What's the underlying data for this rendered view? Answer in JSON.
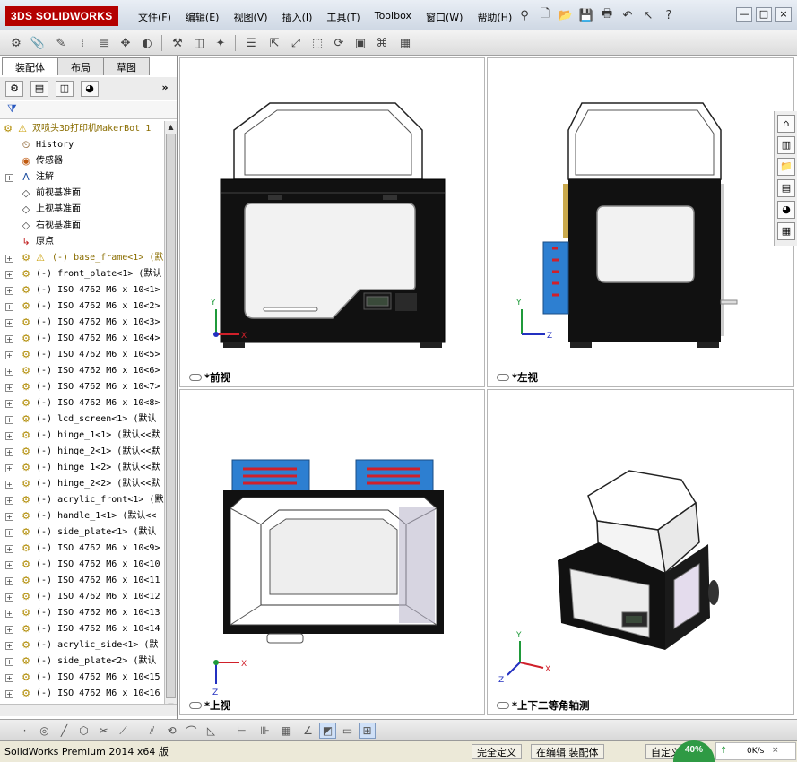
{
  "app": {
    "logo_text": "3DS SOLIDWORKS",
    "menus": [
      "文件(F)",
      "编辑(E)",
      "视图(V)",
      "插入(I)",
      "工具(T)",
      "Toolbox",
      "窗口(W)",
      "帮助(H)"
    ],
    "window_controls": [
      "?",
      "—",
      "□",
      "×"
    ]
  },
  "panel": {
    "tabs": [
      "装配体",
      "布局",
      "草图"
    ],
    "active_tab": "装配体",
    "tree_root": "双喷头3D打印机MakerBot 1",
    "tree_items": [
      {
        "icon": "history-icon",
        "label": "History",
        "expander": ""
      },
      {
        "icon": "sensor-icon",
        "label": "传感器",
        "expander": ""
      },
      {
        "icon": "annotation-icon",
        "label": "注解",
        "expander": "+"
      },
      {
        "icon": "plane-icon",
        "label": "前视基准面",
        "expander": ""
      },
      {
        "icon": "plane-icon",
        "label": "上视基准面",
        "expander": ""
      },
      {
        "icon": "plane-icon",
        "label": "右视基准面",
        "expander": ""
      },
      {
        "icon": "origin-icon",
        "label": "原点",
        "expander": ""
      },
      {
        "icon": "warning-part-icon",
        "label": "(-) base_frame<1> (默",
        "expander": "+",
        "warn": true
      },
      {
        "icon": "part-icon",
        "label": "(-) front_plate<1> (默认",
        "expander": "+"
      },
      {
        "icon": "part-icon",
        "label": "(-) ISO 4762 M6 x 10<1>",
        "expander": "+"
      },
      {
        "icon": "part-icon",
        "label": "(-) ISO 4762 M6 x 10<2>",
        "expander": "+"
      },
      {
        "icon": "part-icon",
        "label": "(-) ISO 4762 M6 x 10<3>",
        "expander": "+"
      },
      {
        "icon": "part-icon",
        "label": "(-) ISO 4762 M6 x 10<4>",
        "expander": "+"
      },
      {
        "icon": "part-icon",
        "label": "(-) ISO 4762 M6 x 10<5>",
        "expander": "+"
      },
      {
        "icon": "part-icon",
        "label": "(-) ISO 4762 M6 x 10<6>",
        "expander": "+"
      },
      {
        "icon": "part-icon",
        "label": "(-) ISO 4762 M6 x 10<7>",
        "expander": "+"
      },
      {
        "icon": "part-icon",
        "label": "(-) ISO 4762 M6 x 10<8>",
        "expander": "+"
      },
      {
        "icon": "part-icon",
        "label": "(-) lcd_screen<1> (默认",
        "expander": "+"
      },
      {
        "icon": "part-icon",
        "label": "(-) hinge_1<1> (默认<<默",
        "expander": "+"
      },
      {
        "icon": "part-icon",
        "label": "(-) hinge_2<1> (默认<<默",
        "expander": "+"
      },
      {
        "icon": "part-icon",
        "label": "(-) hinge_1<2> (默认<<默",
        "expander": "+"
      },
      {
        "icon": "part-icon",
        "label": "(-) hinge_2<2> (默认<<默",
        "expander": "+"
      },
      {
        "icon": "part-icon",
        "label": "(-) acrylic_front<1> (默",
        "expander": "+"
      },
      {
        "icon": "part-icon",
        "label": "(-) handle_1<1> (默认<<",
        "expander": "+"
      },
      {
        "icon": "part-icon",
        "label": "(-) side_plate<1> (默认",
        "expander": "+"
      },
      {
        "icon": "part-icon",
        "label": "(-) ISO 4762 M6 x 10<9>",
        "expander": "+"
      },
      {
        "icon": "part-icon",
        "label": "(-) ISO 4762 M6 x 10<10",
        "expander": "+"
      },
      {
        "icon": "part-icon",
        "label": "(-) ISO 4762 M6 x 10<11",
        "expander": "+"
      },
      {
        "icon": "part-icon",
        "label": "(-) ISO 4762 M6 x 10<12",
        "expander": "+"
      },
      {
        "icon": "part-icon",
        "label": "(-) ISO 4762 M6 x 10<13",
        "expander": "+"
      },
      {
        "icon": "part-icon",
        "label": "(-) ISO 4762 M6 x 10<14",
        "expander": "+"
      },
      {
        "icon": "part-icon",
        "label": "(-) acrylic_side<1> (默",
        "expander": "+"
      },
      {
        "icon": "part-icon",
        "label": "(-) side_plate<2> (默认",
        "expander": "+"
      },
      {
        "icon": "part-icon",
        "label": "(-) ISO 4762 M6 x 10<15",
        "expander": "+"
      },
      {
        "icon": "part-icon",
        "label": "(-) ISO 4762 M6 x 10<16",
        "expander": "+"
      }
    ]
  },
  "views": {
    "front": "*前视",
    "left": "*左视",
    "top": "*上视",
    "iso": "*上下二等角轴测",
    "axis_x": "X",
    "axis_y": "Y",
    "axis_z": "Z"
  },
  "status": {
    "product": "SolidWorks Premium 2014 x64 版",
    "definition": "完全定义",
    "editing": "在编辑 装配体",
    "custom": "自定义",
    "gauge": "40%",
    "net_speed": "0K/s"
  },
  "colors": {
    "accent": "#b40000",
    "frame": "#111111",
    "fan": "#2d7fd1",
    "axis_red": "#d0202a",
    "axis_green": "#1f9a3a",
    "axis_blue": "#2330c0"
  }
}
